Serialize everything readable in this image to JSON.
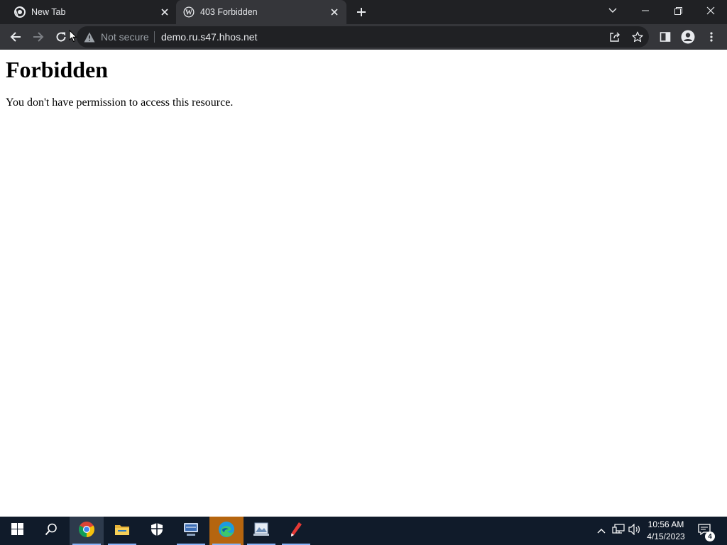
{
  "browser": {
    "tabs": [
      {
        "title": "New Tab",
        "favicon": "chrome-icon",
        "active": false
      },
      {
        "title": "403 Forbidden",
        "favicon": "wordpress-icon",
        "active": true
      }
    ],
    "omnibox": {
      "security_icon": "warning-icon",
      "security_label": "Not secure",
      "url": "demo.ru.s47.hhos.net"
    },
    "colors": {
      "frame": "#202124",
      "toolbar": "#35363a",
      "text": "#e8eaed"
    }
  },
  "page": {
    "heading": "Forbidden",
    "message": "You don't have permission to access this resource."
  },
  "taskbar": {
    "pinned": [
      "windows-start-icon",
      "search-icon",
      "chrome-icon",
      "file-explorer-icon",
      "security-shield-icon",
      "network-manager-icon",
      "edge-icon",
      "image-viewer-icon",
      "pen-tool-icon"
    ],
    "clock": {
      "time": "10:56 AM",
      "date": "4/15/2023"
    },
    "notification_count": "4",
    "colors": {
      "background": "#101b2a",
      "active_app": "#b5650f"
    }
  }
}
